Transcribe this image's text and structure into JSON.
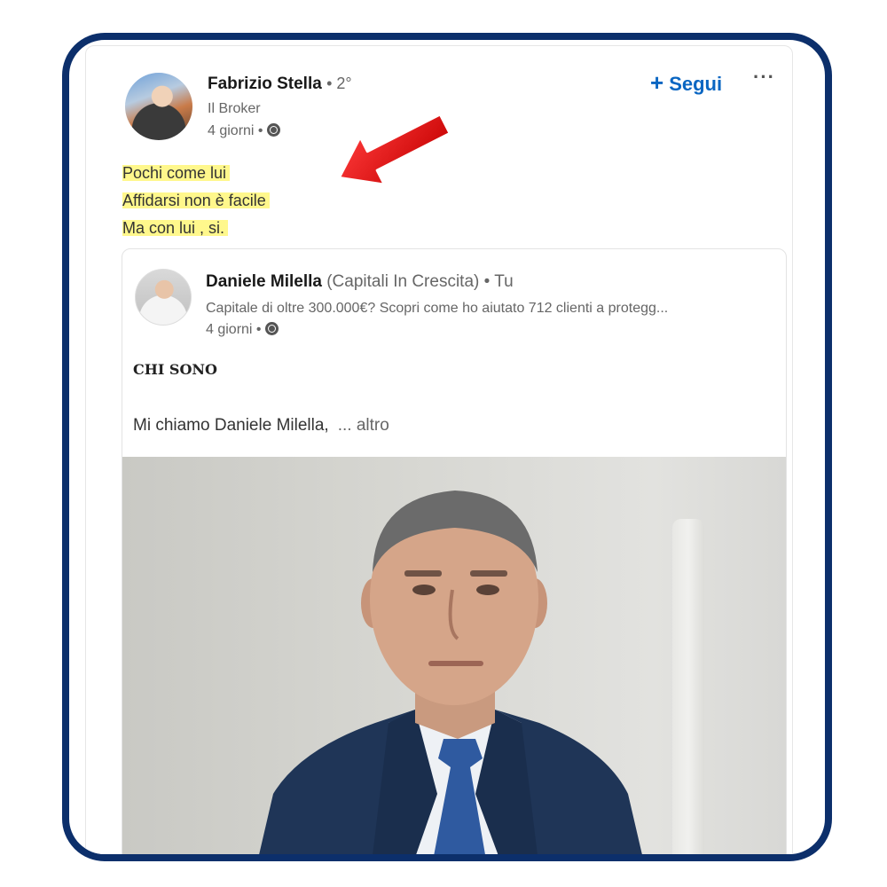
{
  "post": {
    "author_name": "Fabrizio Stella",
    "author_degree": "• 2°",
    "author_headline": "Il Broker",
    "time": "4 giorni •",
    "follow_label": "Segui",
    "follow_icon": "+",
    "more_icon": "···",
    "text_lines": [
      "Pochi come lui",
      "Affidarsi non è facile",
      "Ma con lui , si."
    ]
  },
  "shared": {
    "author_name": "Daniele Milella",
    "author_company": "(Capitali In Crescita)",
    "author_relation": "• Tu",
    "headline": "Capitale di oltre 300.000€? Scopri come ho aiutato 712 clienti a protegg...",
    "time": "4 giorni •",
    "heading": "CHI SONO",
    "body": "Mi chiamo Daniele Milella,",
    "more_label": "... altro"
  },
  "colors": {
    "frame": "#0c2f6b",
    "accent": "#0a66c2",
    "highlight": "#fff678",
    "arrow": "#e00000"
  }
}
